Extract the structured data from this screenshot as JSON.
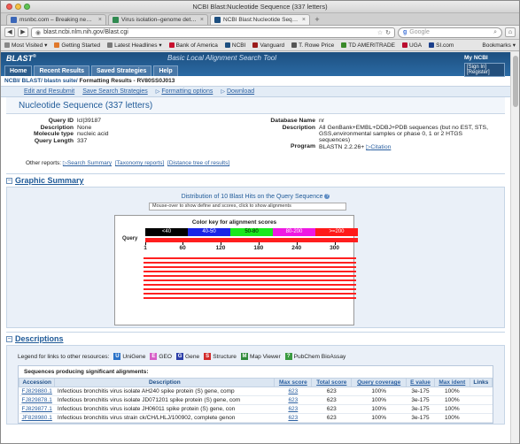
{
  "window": {
    "title": "NCBI Blast:Nucleotide Sequence (337 letters)"
  },
  "tabs": [
    {
      "label": "msnbc.com – Breaking news, sc...",
      "color": "#3a66b8"
    },
    {
      "label": "Virus isolation–genome detection ...",
      "color": "#2f8a50"
    },
    {
      "label": "NCBI Blast:Nucleotide Sequence ...",
      "color": "#1d4f80"
    }
  ],
  "nav": {
    "url": "blast.ncbi.nlm.nih.gov/Blast.cgi",
    "search_placeholder": "Google"
  },
  "bookmarks": [
    {
      "label": "Most Visited ▾",
      "color": "#888888"
    },
    {
      "label": "Getting Started",
      "color": "#e0782b"
    },
    {
      "label": "Latest Headlines ▾",
      "color": "#7a7a7a"
    },
    {
      "label": "Bank of America",
      "color": "#c8102e"
    },
    {
      "label": "NCBI",
      "color": "#1d4f80"
    },
    {
      "label": "Vanguard",
      "color": "#9b1b1b"
    },
    {
      "label": "T. Rowe Price",
      "color": "#555555"
    },
    {
      "label": "TD AMERITRADE",
      "color": "#3a8a2a"
    },
    {
      "label": "UGA",
      "color": "#ba0c2f"
    },
    {
      "label": "SI.com",
      "color": "#1b3f8b"
    }
  ],
  "bookmarks_right": "Bookmarks ▾",
  "ncbi": {
    "logo": "BLAST",
    "logo_sup": "®",
    "subtitle": "Basic Local Alignment Search Tool",
    "menu": [
      "Home",
      "Recent Results",
      "Saved Strategies",
      "Help"
    ],
    "my_ncbi": "My NCBI",
    "sign_in": "[Sign In] [Register]"
  },
  "breadcrumb": {
    "links": "NCBI/ BLAST/ blastn suite/",
    "current": " Formatting Results - RV80SS0J013"
  },
  "toolbar": [
    "Edit and Resubmit",
    "Save Search Strategies",
    "Formatting options",
    "Download"
  ],
  "page_title": "Nucleotide Sequence (337 letters)",
  "query": {
    "left": [
      {
        "k": "Query ID",
        "v": "lcl|39187"
      },
      {
        "k": "Description",
        "v": "None"
      },
      {
        "k": "Molecule type",
        "v": "nucleic acid"
      },
      {
        "k": "Query Length",
        "v": "337"
      }
    ],
    "right": [
      {
        "k": "Database Name",
        "v": "nr"
      },
      {
        "k": "Description",
        "v": "All GenBank+EMBL+DDBJ+PDB sequences (but no EST, STS, GSS,environmental samples or phase 0, 1 or 2 HTGS sequences)"
      },
      {
        "k": "Program",
        "v": "BLASTN 2.2.26+ ",
        "link": "Citation"
      }
    ]
  },
  "other_reports": {
    "label": "Other reports:",
    "links": [
      "Search Summary",
      "[Taxonomy reports]",
      "[Distance tree of results]"
    ]
  },
  "graphic": {
    "section_title": "Graphic Summary",
    "dist_title": "Distribution of 10 Blast Hits on the Query Sequence",
    "mouseover": "Mouse-over to show define and scores, click to show alignments",
    "key_title": "Color key for alignment scores",
    "key": [
      {
        "label": "<40",
        "bg": "#000000",
        "fg": "#ffffff"
      },
      {
        "label": "40-50",
        "bg": "#1b24e6",
        "fg": "#ffffff"
      },
      {
        "label": "50-80",
        "bg": "#19e81d",
        "fg": "#000000"
      },
      {
        "label": "80-200",
        "bg": "#ee19e2",
        "fg": "#ffffff"
      },
      {
        "label": ">=200",
        "bg": "#ff1a1a",
        "fg": "#ffffff"
      }
    ],
    "query_label": "Query",
    "query_length": 337,
    "ticks": [
      1,
      60,
      120,
      180,
      240,
      300
    ],
    "hit_count": 10
  },
  "descriptions": {
    "section_title": "Descriptions",
    "legend_label": "Legend for links to other resources:",
    "legend": [
      {
        "letter": "U",
        "label": "UniGene",
        "color": "#2a72c8"
      },
      {
        "letter": "E",
        "label": "GEO",
        "color": "#d65ec7"
      },
      {
        "letter": "G",
        "label": "Gene",
        "color": "#2d3fa8"
      },
      {
        "letter": "S",
        "label": "Structure",
        "color": "#d22b2b"
      },
      {
        "letter": "M",
        "label": "Map Viewer",
        "color": "#2f8a3a"
      },
      {
        "letter": "?",
        "label": "PubChem BioAssay",
        "color": "#3a9a40"
      }
    ],
    "table_heading": "Sequences producing significant alignments:",
    "columns": [
      "Accession",
      "Description",
      "Max score",
      "Total score",
      "Query coverage",
      "E value",
      "Max ident",
      "Links"
    ],
    "rows": [
      [
        "FJ829880.1",
        "Infectious bronchitis virus isolate AH240 spike protein (S) gene, comp",
        "623",
        "623",
        "100%",
        "3e-175",
        "100%",
        ""
      ],
      [
        "FJ829878.1",
        "Infectious bronchitis virus isolate JD071201 spike protein (S) gene, com",
        "623",
        "623",
        "100%",
        "3e-175",
        "100%",
        ""
      ],
      [
        "FJ829877.1",
        "Infectious bronchitis virus isolate JH06011 spike protein (S) gene, con",
        "623",
        "623",
        "100%",
        "3e-175",
        "100%",
        ""
      ],
      [
        "JF828980.1",
        "Infectious bronchitis virus strain ck/CH/LHLJ/100902, complete genon",
        "623",
        "623",
        "100%",
        "3e-175",
        "100%",
        ""
      ]
    ]
  }
}
